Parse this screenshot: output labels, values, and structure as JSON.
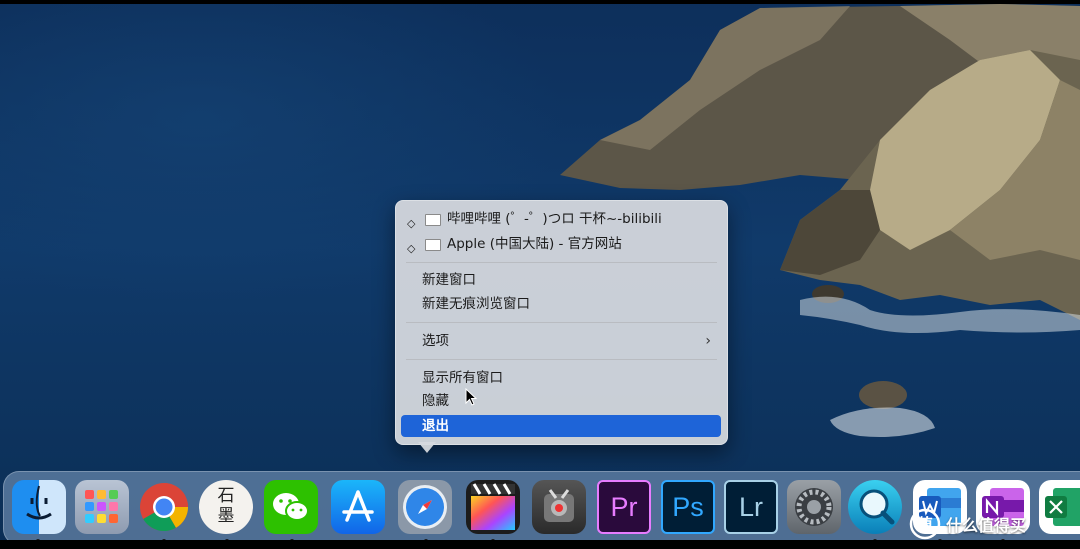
{
  "menu": {
    "windows": [
      {
        "label": "哔哩哔哩 (゜-゜)つロ 干杯~-bilibili"
      },
      {
        "label": "Apple (中国大陆) - 官方网站"
      }
    ],
    "items": {
      "new_window": "新建窗口",
      "new_private_window": "新建无痕浏览窗口",
      "options": "选项",
      "show_all_windows": "显示所有窗口",
      "hide": "隐藏",
      "quit": "退出"
    }
  },
  "dock": {
    "apps": [
      {
        "name": "finder-icon",
        "running": true
      },
      {
        "name": "launchpad-icon",
        "running": false
      },
      {
        "name": "chrome-icon",
        "running": true
      },
      {
        "name": "shimo-icon",
        "label": "石墨",
        "running": true
      },
      {
        "name": "wechat-icon",
        "running": true
      },
      {
        "name": "app-store-icon",
        "running": false
      },
      {
        "name": "safari-icon",
        "running": true
      },
      {
        "name": "final-cut-pro-icon",
        "running": true
      },
      {
        "name": "compressor-icon",
        "running": false
      },
      {
        "name": "premiere-icon",
        "label": "Pr",
        "running": false
      },
      {
        "name": "photoshop-icon",
        "label": "Ps",
        "running": false
      },
      {
        "name": "lightroom-icon",
        "label": "Lr",
        "running": false
      },
      {
        "name": "system-preferences-icon",
        "running": false
      },
      {
        "name": "quicktime-icon",
        "running": true
      },
      {
        "name": "word-icon",
        "running": true
      },
      {
        "name": "onenote-icon",
        "running": true
      },
      {
        "name": "excel-icon",
        "running": false
      }
    ]
  },
  "watermark": "什么值得买",
  "colors": {
    "selection": "#1e64d8",
    "menu_bg": "#d6d9de",
    "premiere": "#2a0a3c",
    "photoshop": "#001e36",
    "lightroom": "#001e36"
  }
}
